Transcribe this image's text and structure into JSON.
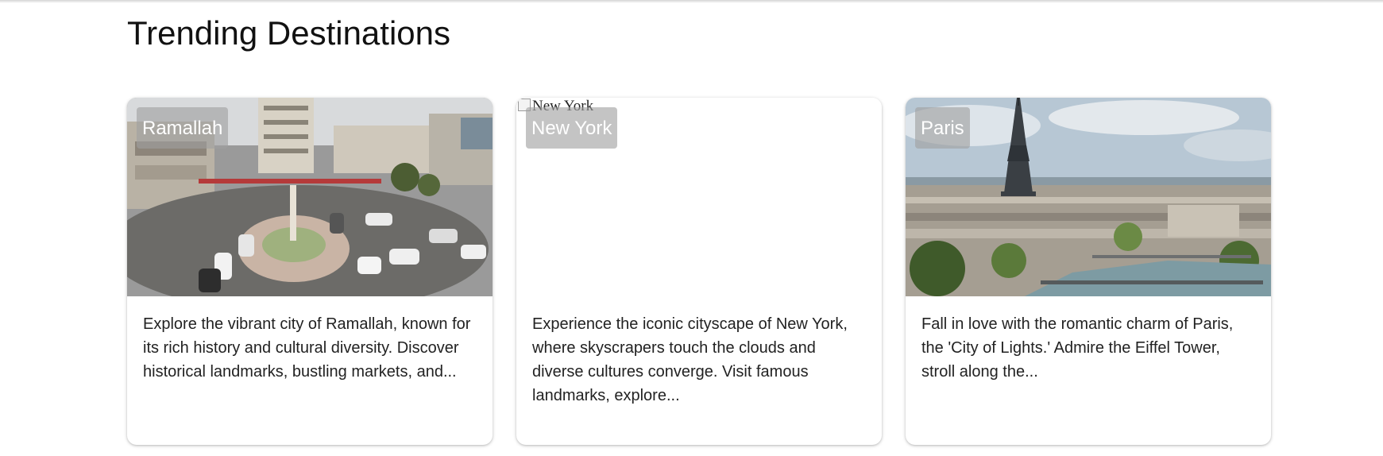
{
  "page": {
    "title": "Trending Destinations"
  },
  "destinations": [
    {
      "name": "Ramallah",
      "image_alt": "Ramallah",
      "description": "Explore the vibrant city of Ramallah, known for its rich history and cultural diversity. Discover historical landmarks, bustling markets, and..."
    },
    {
      "name": "New York",
      "image_alt": "New York",
      "description": "Experience the iconic cityscape of New York, where skyscrapers touch the clouds and diverse cultures converge. Visit famous landmarks, explore..."
    },
    {
      "name": "Paris",
      "image_alt": "Paris",
      "description": "Fall in love with the romantic charm of Paris, the 'City of Lights.' Admire the Eiffel Tower, stroll along the..."
    }
  ],
  "colors": {
    "badge_background": "#a0a0a0",
    "badge_text": "#ffffff",
    "card_background": "#ffffff"
  }
}
